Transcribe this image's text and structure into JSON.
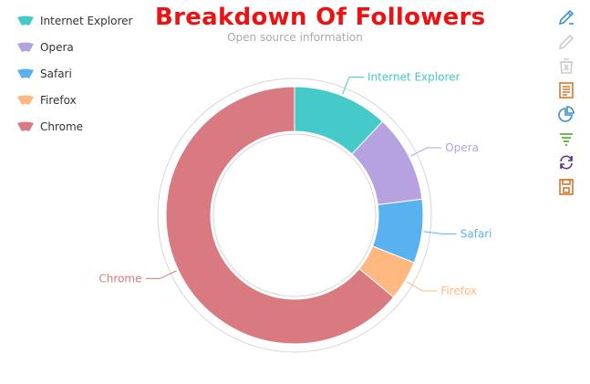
{
  "chart_data": {
    "type": "pie",
    "title": "Breakdown Of Followers",
    "subtitle": "Open source information",
    "donut": true,
    "legend_position": "top-left",
    "slices": [
      {
        "name": "Internet Explorer",
        "value": 12,
        "color": "#45c9c9"
      },
      {
        "name": "Opera",
        "value": 11,
        "color": "#b6a2de"
      },
      {
        "name": "Safari",
        "value": 8,
        "color": "#5ab1ef"
      },
      {
        "name": "Firefox",
        "value": 5,
        "color": "#ffb980"
      },
      {
        "name": "Chrome",
        "value": 64,
        "color": "#d87a80"
      }
    ]
  },
  "toolbox": {
    "items": [
      {
        "icon": "edit-pen-icon",
        "color": "#3a91d4"
      },
      {
        "icon": "pen-disabled-icon",
        "color": "#cccccc"
      },
      {
        "icon": "clear-disabled-icon",
        "color": "#cccccc"
      },
      {
        "icon": "data-view-icon",
        "color": "#d9752a"
      },
      {
        "icon": "pie-type-icon",
        "color": "#3a91d4"
      },
      {
        "icon": "funnel-icon",
        "color": "#5ab230"
      },
      {
        "icon": "restore-icon",
        "color": "#5b2c91"
      },
      {
        "icon": "save-image-icon",
        "color": "#d9752a"
      }
    ]
  }
}
